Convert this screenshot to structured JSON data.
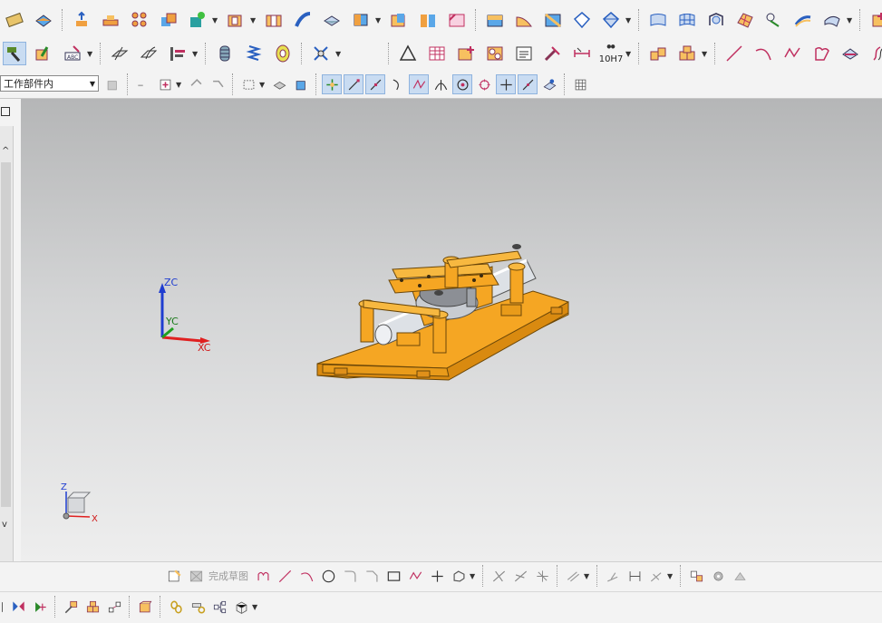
{
  "selection_filter": {
    "value": "工作部件内"
  },
  "sketch_toolbar": {
    "finish_sketch_label": "完成草图"
  },
  "toolbar_row2": {
    "tolerance_label": "10H7"
  },
  "wcs_axes": {
    "zc": "ZC",
    "yc": "YC",
    "xc": "XC"
  },
  "view_triad": {
    "z": "Z",
    "x": "X"
  },
  "colors": {
    "accent_orange": "#f5a623",
    "toolbar_bg": "#f3f3f3",
    "active_blue": "#c9dcf2"
  }
}
